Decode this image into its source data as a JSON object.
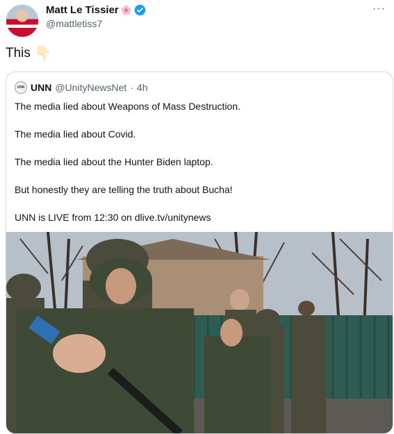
{
  "tweet": {
    "display_name": "Matt Le Tissier",
    "name_emoji": "🌸",
    "handle": "@mattletiss7",
    "more_label": "···",
    "text": "This",
    "text_emoji": "👇"
  },
  "quoted": {
    "logo_text": "UNN",
    "display_name": "UNN",
    "handle": "@UnityNewsNet",
    "separator": "·",
    "time": "4h",
    "lines": [
      "The media lied about Weapons of Mass Destruction.",
      "The media lied about Covid.",
      "The media lied about the Hunter Biden laptop.",
      "But honestly they are telling the truth about Bucha!",
      "UNN is LIVE from 12:30 on dlive.tv/unitynews"
    ]
  },
  "colors": {
    "verified": "#1d9bf0",
    "muted_text": "#536471",
    "border": "#cfd9de"
  },
  "icons": [
    "verified-badge-icon",
    "more-icon",
    "pointing-down-icon"
  ]
}
